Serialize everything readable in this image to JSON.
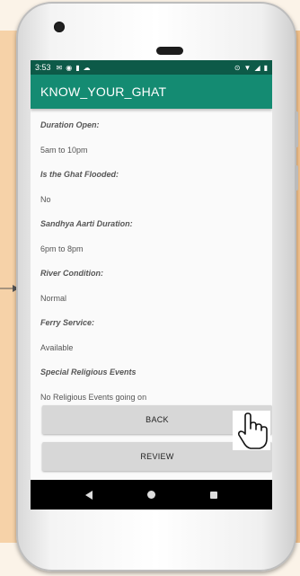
{
  "status_bar": {
    "time": "3:53"
  },
  "app_bar": {
    "title": "KNOW_YOUR_GHAT"
  },
  "details": [
    {
      "label": "Duration Open:",
      "value": "5am to 10pm"
    },
    {
      "label": "Is the Ghat Flooded:",
      "value": "No"
    },
    {
      "label": "Sandhya Aarti Duration:",
      "value": "6pm to 8pm"
    },
    {
      "label": "River Condition:",
      "value": "Normal"
    },
    {
      "label": "Ferry Service:",
      "value": "Available"
    },
    {
      "label": "Special Religious Events",
      "value": "No Religious Events going on"
    }
  ],
  "buttons": {
    "back_label": "BACK",
    "review_label": "REVIEW"
  },
  "colors": {
    "app_bar": "#148b72",
    "status_bar": "#0d5a48",
    "button": "#d7d7d7",
    "background": "#f3c28c"
  },
  "icons": [
    "hand-pointer-icon",
    "nav-back-icon",
    "nav-home-icon",
    "nav-recent-apps-icon"
  ]
}
